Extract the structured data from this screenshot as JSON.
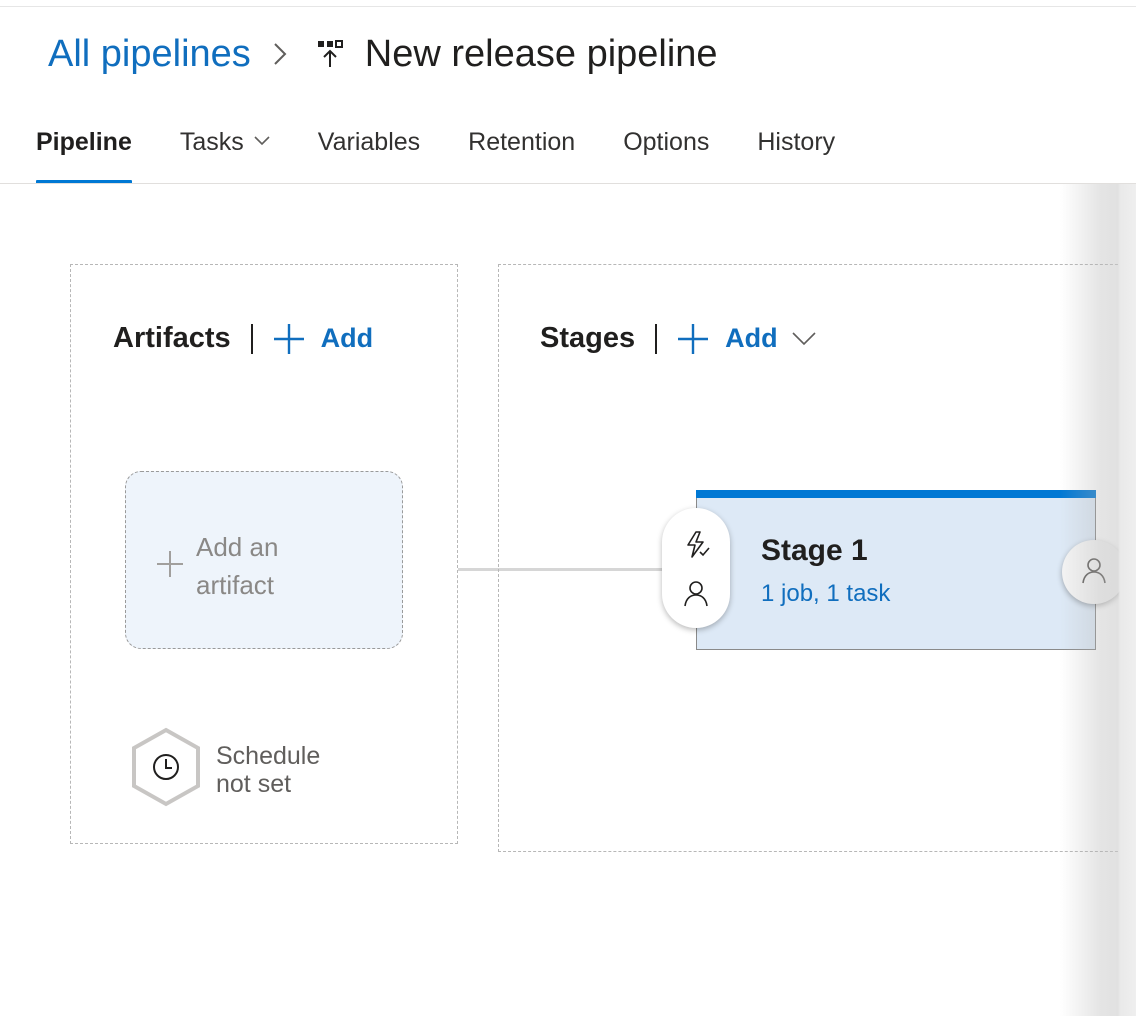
{
  "header": {
    "breadcrumb_link": "All pipelines",
    "title": "New release pipeline",
    "title_icon": "release-pipeline-icon"
  },
  "tabs": [
    {
      "label": "Pipeline",
      "active": true
    },
    {
      "label": "Tasks",
      "has_dropdown": true
    },
    {
      "label": "Variables"
    },
    {
      "label": "Retention"
    },
    {
      "label": "Options"
    },
    {
      "label": "History"
    }
  ],
  "artifacts": {
    "title": "Artifacts",
    "add_label": "Add",
    "add_artifact_label": "Add an artifact",
    "schedule_label": "Schedule not set",
    "schedule_icon": "clock-icon"
  },
  "stages": {
    "title": "Stages",
    "add_label": "Add",
    "items": [
      {
        "name": "Stage 1",
        "summary": "1 job, 1 task"
      }
    ],
    "pre_deployment_icons": [
      "lightning-trigger-icon",
      "person-approver-icon"
    ],
    "post_deployment_icon": "person-approver-icon"
  },
  "colors": {
    "accent": "#0078d4",
    "link": "#106ebe",
    "stage_bg": "#dde9f6",
    "artifact_bg": "#eef4fb"
  }
}
